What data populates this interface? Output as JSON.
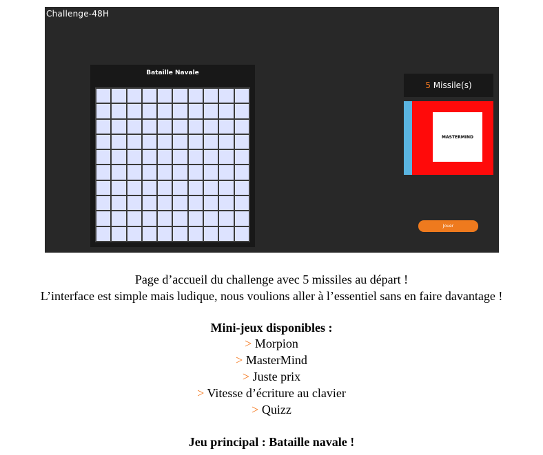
{
  "screenshot": {
    "app_title": "Challenge-48H",
    "board_title": "Bataille Navale",
    "missiles": {
      "count": "5",
      "label": "Missile(s)"
    },
    "game_card_logo": "MASTERMIND",
    "play_button": "Jouer"
  },
  "caption": {
    "line1": "Page d’accueil du challenge avec 5 missiles au départ !",
    "line2": "L’interface est simple mais ludique, nous voulions aller à l’essentiel sans en faire davantage !"
  },
  "minigames": {
    "heading": "Mini-jeux disponibles :",
    "arrow": ">",
    "items": [
      "Morpion",
      "MasterMind",
      "Juste prix",
      "Vitesse d’écriture au clavier",
      "Quizz"
    ]
  },
  "main_game": "Jeu principal : Bataille navale !",
  "colors": {
    "accent": "#f47920",
    "card_red": "#ff0a0a",
    "card_stripe": "#5ab4e0",
    "grid_cell": "#dde3ff"
  }
}
